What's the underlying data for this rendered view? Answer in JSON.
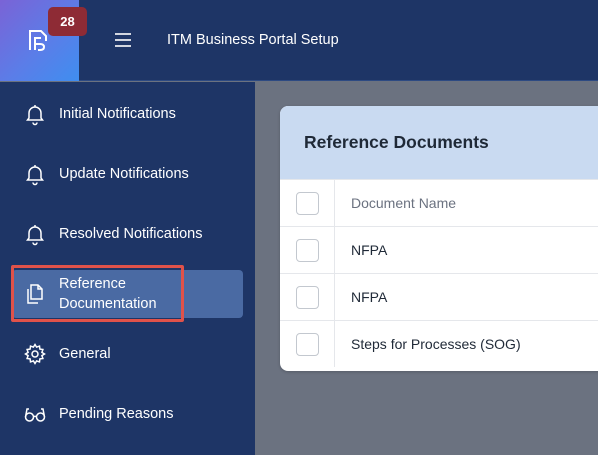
{
  "header": {
    "badge_count": "28",
    "app_title": "ITM Business Portal Setup"
  },
  "sidebar": {
    "items": [
      {
        "label": "Initial Notifications",
        "icon": "bell-icon"
      },
      {
        "label": "Update Notifications",
        "icon": "bell-icon"
      },
      {
        "label": "Resolved Notifications",
        "icon": "bell-icon"
      },
      {
        "label_line1": "Reference",
        "label_line2": "Documentation",
        "icon": "documents-icon",
        "active": true
      },
      {
        "label": "General",
        "icon": "gear-icon"
      },
      {
        "label": "Pending Reasons",
        "icon": "glasses-icon"
      }
    ]
  },
  "main": {
    "card_title": "Reference Documents",
    "table": {
      "column_header": "Document Name",
      "rows": [
        "NFPA",
        "NFPA",
        "Steps for Processes (SOG)"
      ]
    }
  },
  "colors": {
    "sidebar_bg": "#1e3566",
    "active_item_bg": "#4a6aa3",
    "highlight_border": "#e0524a",
    "badge_bg": "#8e2b35",
    "card_header_bg": "#c9daf1"
  }
}
